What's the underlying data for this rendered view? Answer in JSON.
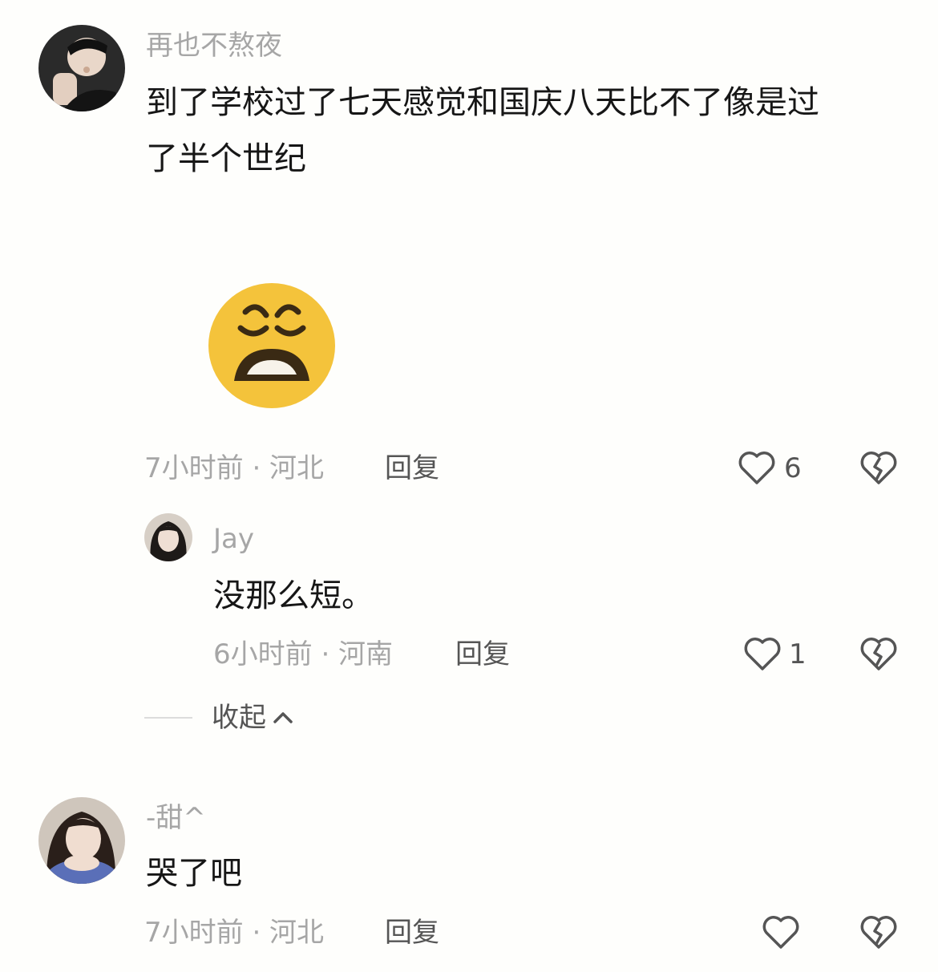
{
  "comments": [
    {
      "username": "再也不熬夜",
      "text_line1": "到了学校过了七天感觉和国庆八天比不了像是过",
      "text_line2": "了半个世纪",
      "emoji": "weary-face-emoji",
      "time_location": "7小时前 · 河北",
      "reply_label": "回复",
      "likes": "6",
      "reply": {
        "username": "Jay",
        "text": "没那么短。",
        "time_location": "6小时前 · 河南",
        "reply_label": "回复",
        "likes": "1"
      },
      "collapse_label": "收起"
    },
    {
      "username": "-甜^",
      "text": "哭了吧",
      "time_location": "7小时前 · 河北",
      "reply_label": "回复",
      "likes": ""
    }
  ],
  "icons": {
    "like": "heart-outline-icon",
    "dislike": "broken-heart-icon",
    "collapse": "chevron-up-icon"
  },
  "colors": {
    "background": "#fefefc",
    "text": "#161616",
    "muted": "#a6a6a6",
    "emoji": "#f4c33b"
  }
}
